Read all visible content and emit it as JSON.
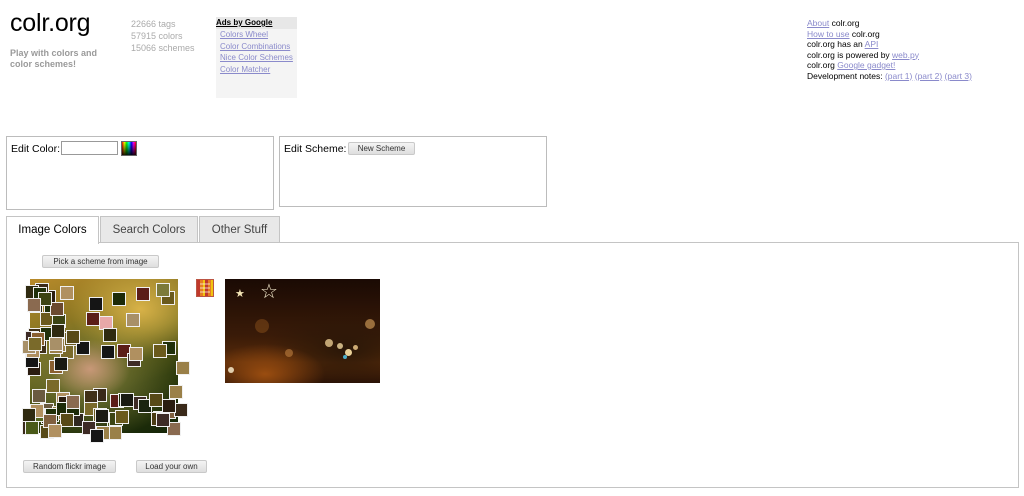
{
  "header": {
    "logo": "colr.org",
    "tagline": "Play with colors and color schemes!",
    "stats": [
      "22666 tags",
      "57915 colors",
      "15066 schemes"
    ]
  },
  "ads": {
    "title": "Ads by Google",
    "links": [
      "Colors Wheel",
      "Color Combinations",
      "Nice Color Schemes",
      "Color Matcher"
    ]
  },
  "about": {
    "about_link": "About",
    "about_text": " colr.org",
    "howto_link": "How to use",
    "howto_text": " colr.org",
    "api_text": "colr.org has an ",
    "api_link": "API",
    "powered_text": "colr.org is powered by ",
    "powered_link": "web.py",
    "gadget_text": "colr.org ",
    "gadget_link": "Google gadget!",
    "dev_text": "Development notes: ",
    "dev_links": [
      "(part 1)",
      "(part 2)",
      "(part 3)"
    ]
  },
  "edit": {
    "color_label": "Edit Color:",
    "color_value": "",
    "scheme_label": "Edit Scheme:",
    "new_scheme_button": "New Scheme"
  },
  "tabs": [
    {
      "label": "Image Colors",
      "active": true
    },
    {
      "label": "Search Colors",
      "active": false
    },
    {
      "label": "Other Stuff",
      "active": false
    }
  ],
  "image_panel": {
    "pick_button": "Pick a scheme from image",
    "random_button": "Random flickr image",
    "load_button": "Load your own",
    "leaf_swatch_colors": [
      "#2f2a10",
      "#4b3d14",
      "#6a5a1c",
      "#3c4413",
      "#1d2a08",
      "#7a6a2a",
      "#584a18",
      "#2b1d10",
      "#8a6030",
      "#1a1a12",
      "#3a2a1a",
      "#5b1e18",
      "#e8a8a8",
      "#6a5a40",
      "#20300a",
      "#4a5a18",
      "#7c7a3a",
      "#302820",
      "#1a2410",
      "#9a8048",
      "#6b4a30",
      "#8a6a50",
      "#a89068",
      "#403018",
      "#556620",
      "#28380c",
      "#151515",
      "#3d2b25",
      "#806040",
      "#b09060"
    ],
    "accent_colors": {
      "link": "#8a8acb",
      "border": "#bcbcbc",
      "tab_inactive": "#e8e8e8"
    }
  }
}
